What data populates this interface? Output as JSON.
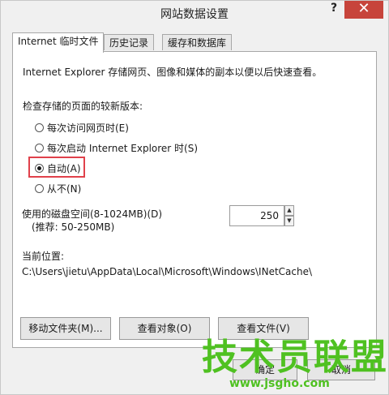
{
  "window": {
    "title": "网站数据设置",
    "help": "?",
    "close": "✕"
  },
  "tabs": [
    {
      "label": "Internet 临时文件",
      "active": true
    },
    {
      "label": "历史记录",
      "active": false
    },
    {
      "label": "缓存和数据库",
      "active": false
    }
  ],
  "panel": {
    "description": "Internet Explorer 存储网页、图像和媒体的副本以便以后快速查看。",
    "check_label": "检查存储的页面的较新版本:",
    "radios": [
      {
        "label": "每次访问网页时(E)",
        "checked": false
      },
      {
        "label": "每次启动 Internet Explorer 时(S)",
        "checked": false
      },
      {
        "label": "自动(A)",
        "checked": true
      },
      {
        "label": "从不(N)",
        "checked": false
      }
    ],
    "disk_label": "使用的磁盘空间(8-1024MB)(D)",
    "disk_hint": "(推荐: 50-250MB)",
    "disk_value": "250",
    "location_label": "当前位置:",
    "location_path": "C:\\Users\\jietu\\AppData\\Local\\Microsoft\\Windows\\INetCache\\",
    "buttons": {
      "move_folder": "移动文件夹(M)...",
      "view_objects": "查看对象(O)",
      "view_files": "查看文件(V)"
    }
  },
  "bottom": {
    "ok": "确定",
    "cancel": "取消"
  },
  "watermark": {
    "brand": "技术员联盟",
    "url": "www.jsgho.com"
  },
  "colors": {
    "close_red": "#c7443b",
    "highlight_red": "#e0414b",
    "watermark_green": "#4fc121"
  }
}
